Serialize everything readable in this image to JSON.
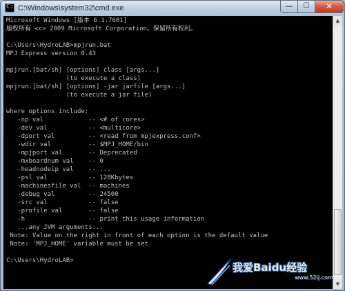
{
  "window": {
    "title": "C:\\Windows\\system32\\cmd.exe",
    "icon": "cmd-icon",
    "controls": {
      "minimize": "—",
      "maximize": "☐",
      "close": "✕"
    }
  },
  "console": {
    "colors": {
      "background": "#000000",
      "text": "#c0c0c0"
    },
    "lines": [
      "Microsoft Windows [版本 6.1.7601]",
      "版权所有 <c> 2009 Microsoft Corporation。保留所有权利。",
      "",
      "C:\\Users\\HydroLAB>mpjrun.bat",
      "MPJ Express version 0.43",
      "",
      "mpjrun.[bat/sh] [options] class [args...]",
      "                (to execute a class)",
      "mpjrun.[bat/sh] [options] -jar jarfile [args...]",
      "                (to execute a jar file)",
      "",
      "where options include:",
      "   -np val            -- <# of cores>",
      "   -dev val           -- <multicore>",
      "   -dport val         -- <read from mpjexpress.conf>",
      "   -wdir val          -- $MPJ_HOME/bin",
      "   -mpjport val       -- Deprecated",
      "   -mxboardnum val    -- 0",
      "   -headnodeip val    -- ...",
      "   -psl val           -- 128Kbytes",
      "   -machinesfile val  -- machines",
      "   -debug val         -- 24500",
      "   -src val           -- false",
      "   -profile val       -- false",
      "   -h                 -- print this usage information",
      "   ...any JVM arguments...",
      " Note: Value on the right in front of each option is the default value",
      " Note: 'MPJ_HOME' variable must be set",
      "",
      "C:\\Users\\HydroLAB>"
    ]
  },
  "scrollbar": {
    "up_arrow": "▲",
    "down_arrow": "▼"
  },
  "watermark": {
    "text": "我爱Baidu经验",
    "sub": "www.52ij.com"
  }
}
